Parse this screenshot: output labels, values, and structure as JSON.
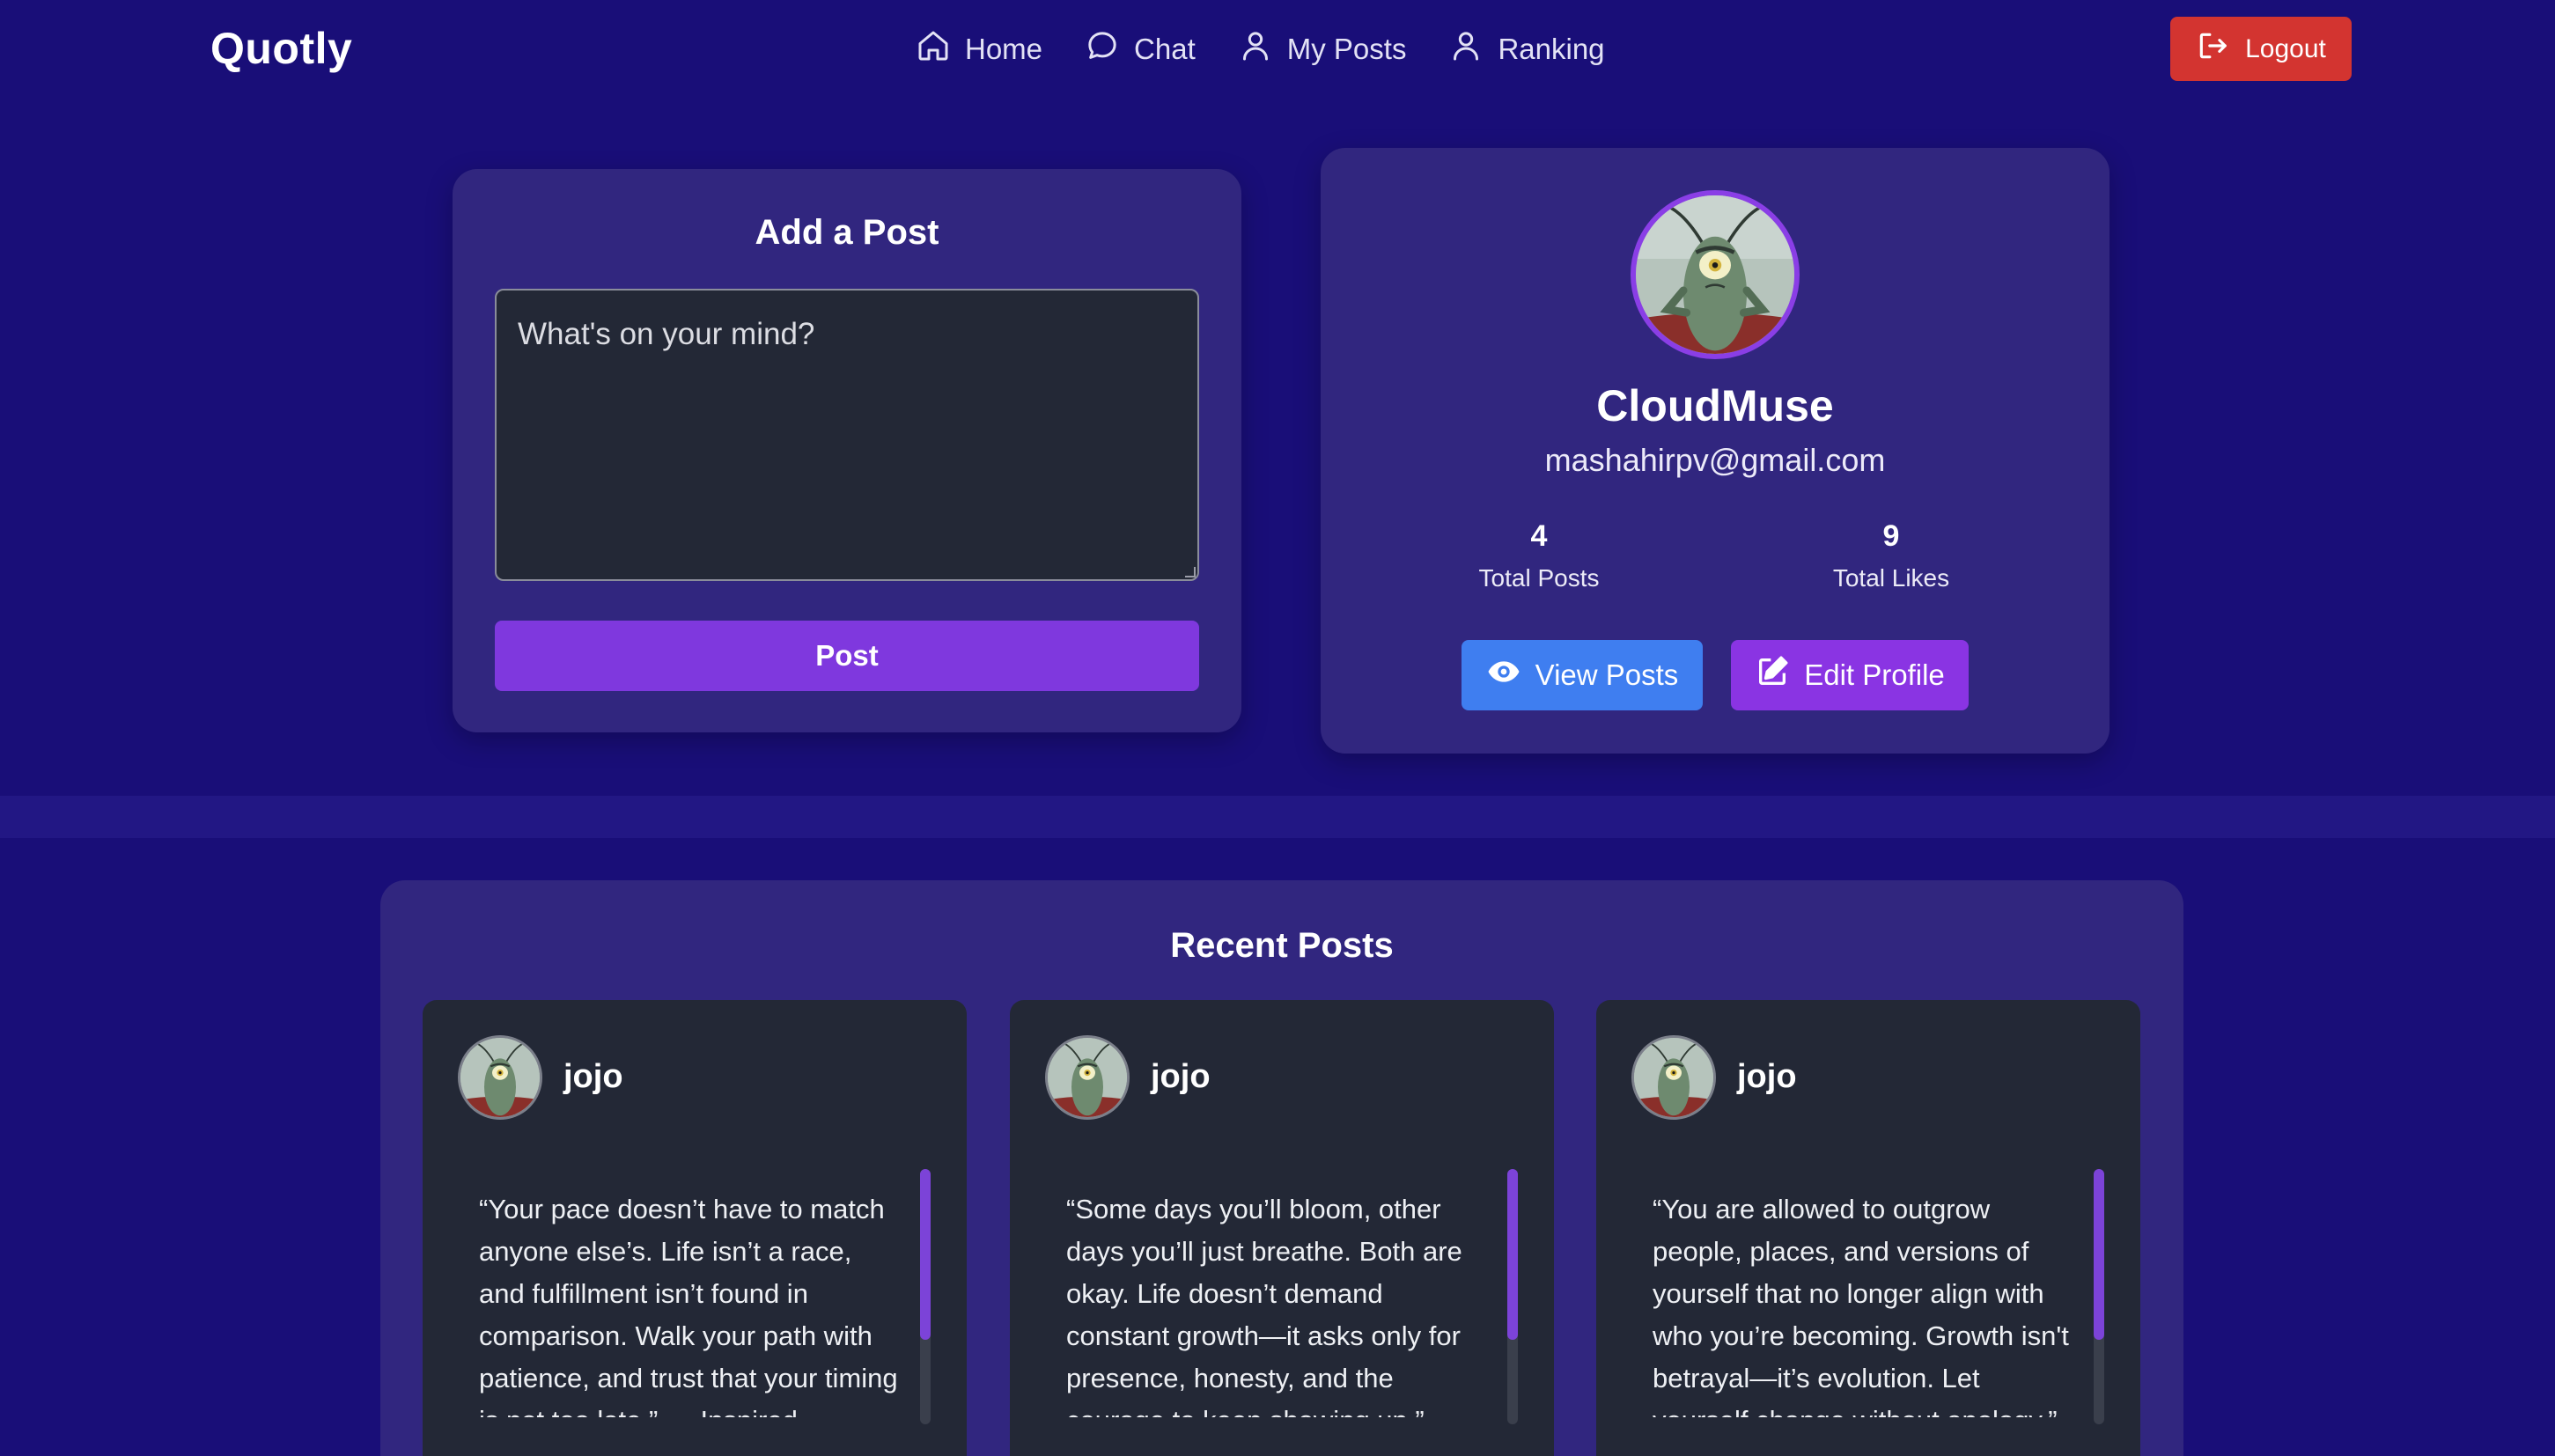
{
  "brand": "Quotly",
  "nav": {
    "items": [
      {
        "label": "Home",
        "icon": "home-icon"
      },
      {
        "label": "Chat",
        "icon": "chat-icon"
      },
      {
        "label": "My Posts",
        "icon": "user-icon"
      },
      {
        "label": "Ranking",
        "icon": "user-icon"
      }
    ],
    "logout_label": "Logout"
  },
  "add_post": {
    "title": "Add a Post",
    "placeholder": "What's on your mind?",
    "button_label": "Post"
  },
  "profile": {
    "name": "CloudMuse",
    "email": "mashahirpv@gmail.com",
    "total_posts": "4",
    "total_posts_label": "Total Posts",
    "total_likes": "9",
    "total_likes_label": "Total Likes",
    "view_posts_label": "View Posts",
    "edit_profile_label": "Edit Profile"
  },
  "recent_posts": {
    "title": "Recent Posts",
    "posts": [
      {
        "author": "jojo",
        "text": "“Your pace doesn’t have to match anyone else’s. Life isn’t a race, and fulfillment isn’t found in comparison. Walk your path with patience, and trust that your timing is not too late.” — Inspired"
      },
      {
        "author": "jojo",
        "text": "“Some days you’ll bloom, other days you’ll just breathe. Both are okay. Life doesn’t demand constant growth—it asks only for presence, honesty, and the courage to keep showing up.”"
      },
      {
        "author": "jojo",
        "text": "“You are allowed to outgrow people, places, and versions of yourself that no longer align with who you’re becoming. Growth isn't betrayal—it’s evolution. Let yourself change without apology.”"
      }
    ]
  },
  "colors": {
    "background": "#190e78",
    "card": "#31267f",
    "accent_purple": "#7f38de",
    "logout_red": "#d33430",
    "view_posts_blue": "#3f7ef0"
  }
}
